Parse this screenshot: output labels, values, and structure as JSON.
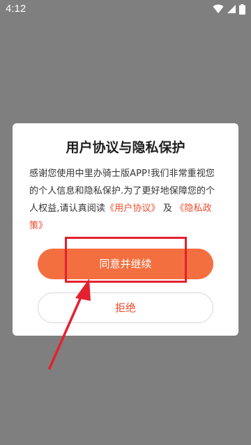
{
  "status_bar": {
    "time": "4:12",
    "icons": [
      "wifi-icon",
      "signal-icon",
      "battery-icon"
    ]
  },
  "dialog": {
    "title": "用户协议与隐私保护",
    "body_text": "感谢您使用中里办骑士版APP!我们非常重视您的个人信息和隐私保护.为了更好地保障您的个人权益,请认真阅读",
    "user_agreement_link": "《用户协议》",
    "and_text": "及",
    "privacy_policy_link": "《隐私政策》",
    "agree_button": "同意并继续",
    "reject_button": "拒绝"
  },
  "annotation": {
    "color": "#e3212f",
    "type": "highlight-box-with-arrow"
  },
  "colors": {
    "overlay": "#7f7f7f",
    "accent": "#f46f3f",
    "link": "#ee4b2b"
  }
}
